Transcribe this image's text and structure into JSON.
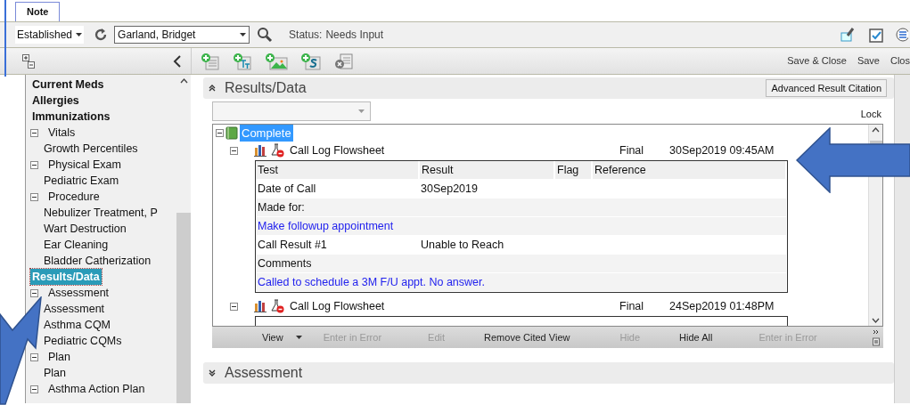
{
  "tabs": [
    {
      "label": "Note",
      "selected": true
    }
  ],
  "toolbar": {
    "visit_type": "Established",
    "patient": "Garland, Bridget",
    "status_label": "Status:",
    "status_value": "Needs Input"
  },
  "actions": [
    "Save & Close",
    "Save",
    "Clos"
  ],
  "sidebar": {
    "items": [
      {
        "kind": "heading",
        "label": "Current Meds",
        "selected": false
      },
      {
        "kind": "heading",
        "label": "Allergies",
        "selected": false
      },
      {
        "kind": "heading",
        "label": "Immunizations",
        "selected": false
      },
      {
        "kind": "group",
        "label": "Vitals",
        "selected": false,
        "expanded": true,
        "children": [
          {
            "label": "Growth Percentiles",
            "selected": false
          }
        ]
      },
      {
        "kind": "group",
        "label": "Physical Exam",
        "selected": false,
        "expanded": true,
        "children": [
          {
            "label": "Pediatric Exam",
            "selected": false
          }
        ]
      },
      {
        "kind": "group",
        "label": "Procedure",
        "selected": false,
        "expanded": true,
        "children": [
          {
            "label": "Nebulizer Treatment, P",
            "selected": false
          },
          {
            "label": "Wart Destruction",
            "selected": false
          },
          {
            "label": "Ear Cleaning",
            "selected": false
          },
          {
            "label": "Bladder Catherization",
            "selected": false
          }
        ]
      },
      {
        "kind": "heading",
        "label": "Results/Data",
        "selected": true
      },
      {
        "kind": "group",
        "label": "Assessment",
        "selected": false,
        "expanded": true,
        "children": [
          {
            "label": "Assessment",
            "selected": false
          },
          {
            "label": "Asthma CQM",
            "selected": false
          },
          {
            "label": "Pediatric CQMs",
            "selected": false
          }
        ]
      },
      {
        "kind": "group",
        "label": "Plan",
        "selected": false,
        "expanded": true,
        "children": [
          {
            "label": "Plan",
            "selected": false
          }
        ]
      },
      {
        "kind": "group",
        "label": "Asthma Action Plan",
        "selected": false,
        "expanded": true
      }
    ]
  },
  "results_section": {
    "title": "Results/Data",
    "expanded": true,
    "citation_button": "Advanced Result Citation",
    "lock": "Lock",
    "root": {
      "label": "Complete",
      "selected": true,
      "expanded": true
    },
    "entries": [
      {
        "name": "Call Log Flowsheet",
        "status": "Final",
        "datetime": "30Sep2019 09:45AM",
        "expanded": true,
        "columns": [
          "Test",
          "Result",
          "Flag",
          "Reference"
        ],
        "rows": [
          {
            "kind": "value",
            "test": "Date of Call",
            "result": "30Sep2019"
          },
          {
            "kind": "value",
            "test": "Made for:",
            "result": ""
          },
          {
            "kind": "note",
            "text": "Make followup appointment"
          },
          {
            "kind": "value",
            "test": "Call Result #1",
            "result": "Unable to Reach"
          },
          {
            "kind": "value",
            "test": "Comments",
            "result": ""
          },
          {
            "kind": "note",
            "text": "Called to schedule a 3M F/U appt. No answer."
          }
        ]
      },
      {
        "name": "Call Log Flowsheet",
        "status": "Final",
        "datetime": "24Sep2019 01:48PM",
        "expanded": true
      }
    ],
    "bar_actions": [
      {
        "label": "View",
        "kind": "menu",
        "disabled": false
      },
      {
        "label": "Enter in Error",
        "kind": "plain",
        "disabled": true
      },
      {
        "label": "Edit",
        "kind": "plain",
        "disabled": true
      },
      {
        "label": "Remove Cited View",
        "kind": "plain",
        "disabled": false
      },
      {
        "label": "Hide",
        "kind": "plain",
        "disabled": true
      },
      {
        "label": "Hide All",
        "kind": "plain",
        "disabled": false
      },
      {
        "label": "Enter in Error",
        "kind": "plain",
        "disabled": true
      }
    ]
  },
  "sections": [
    {
      "title": "Assessment",
      "expanded": false
    }
  ]
}
